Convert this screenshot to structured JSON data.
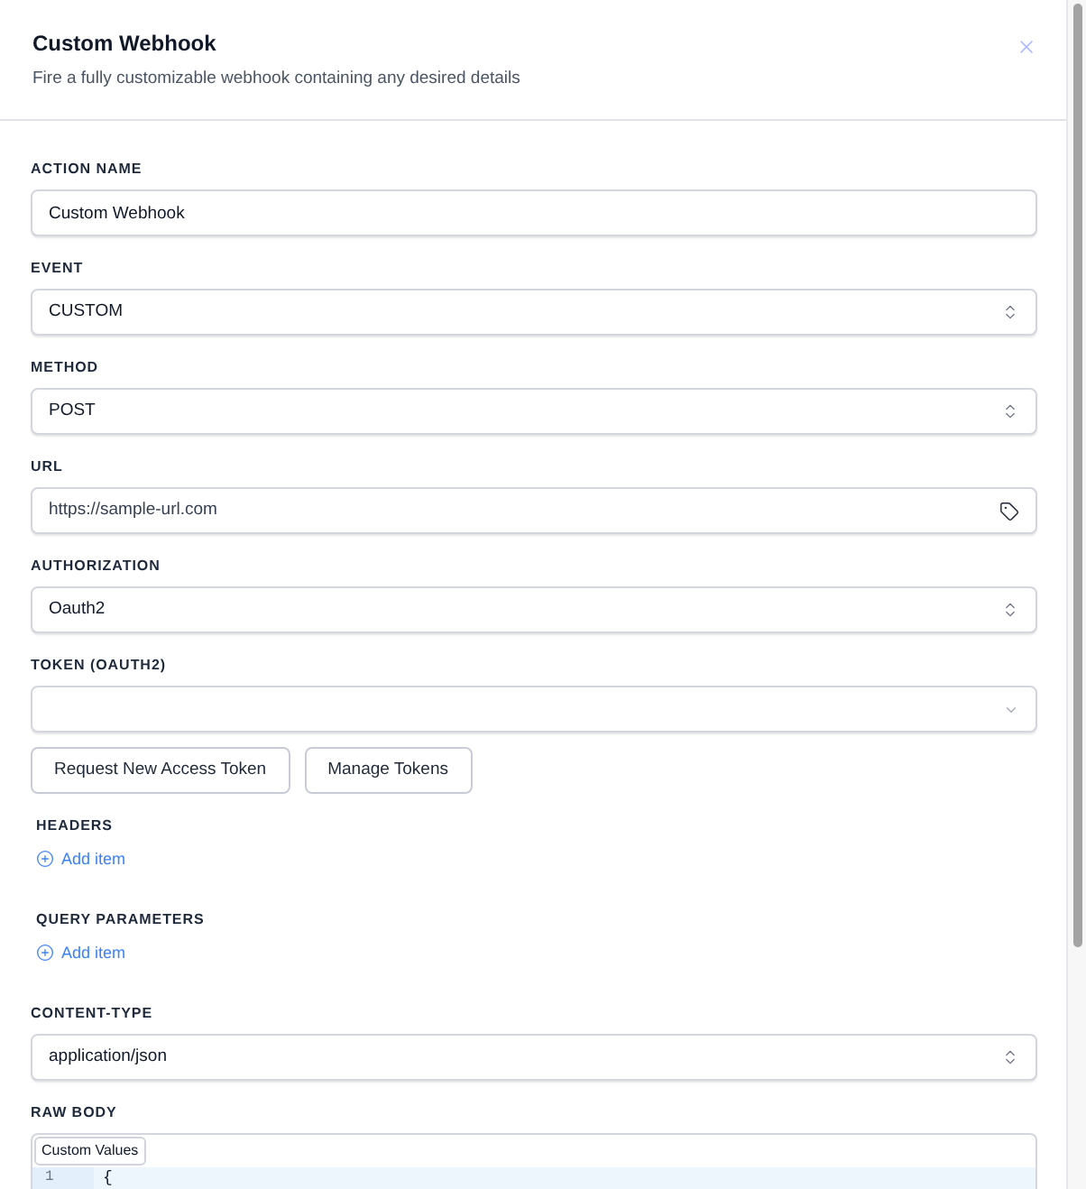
{
  "dialog": {
    "title": "Custom Webhook",
    "subtitle": "Fire a fully customizable webhook containing any desired details"
  },
  "fields": [
    {
      "kind": "text",
      "label": "ACTION NAME",
      "value": "Custom Webhook"
    },
    {
      "kind": "select",
      "label": "EVENT",
      "value": "CUSTOM"
    },
    {
      "kind": "select",
      "label": "METHOD",
      "value": "POST"
    },
    {
      "kind": "tag-input",
      "label": "URL",
      "value": "https://sample-url.com"
    },
    {
      "kind": "select",
      "label": "AUTHORIZATION",
      "value": "Oauth2"
    },
    {
      "kind": "dropdown",
      "label": "TOKEN (OAUTH2)",
      "buttons": [
        "Request New Access Token",
        "Manage Tokens"
      ]
    },
    {
      "kind": "list",
      "label": "HEADERS",
      "action": "Add item"
    },
    {
      "kind": "list",
      "label": "QUERY PARAMETERS",
      "action": "Add item"
    },
    {
      "kind": "select",
      "label": "CONTENT-TYPE",
      "value": "application/json"
    },
    {
      "kind": "code",
      "label": "RAW BODY",
      "toolbar_button": "Custom Values",
      "lines": [
        {
          "number": "1",
          "text": "{"
        }
      ]
    }
  ]
}
